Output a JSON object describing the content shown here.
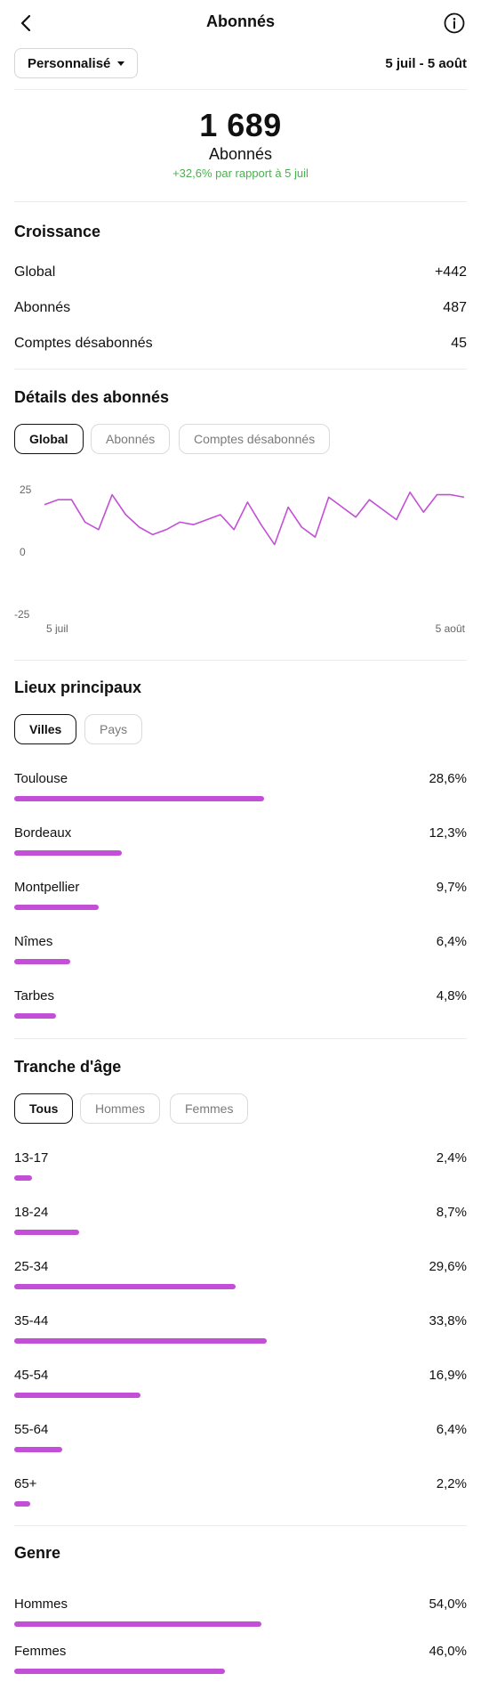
{
  "header": {
    "title": "Abonnés",
    "back_icon": "back-arrow-icon",
    "info_icon": "info-icon"
  },
  "period": {
    "selected": "Personnalisé",
    "date_range": "5 juil - 5 août"
  },
  "summary": {
    "count": "1 689",
    "label": "Abonnés",
    "change": "+32,6% par rapport à 5 juil",
    "change_color": "#4caf50"
  },
  "growth": {
    "title": "Croissance",
    "rows": [
      {
        "label": "Global",
        "value": "+442"
      },
      {
        "label": "Abonnés",
        "value": "487"
      },
      {
        "label": "Comptes désabonnés",
        "value": "45"
      }
    ]
  },
  "details": {
    "title": "Détails des abonnés",
    "tabs": [
      "Global",
      "Abonnés",
      "Comptes désabonnés"
    ],
    "active_tab": "Global"
  },
  "chart_data": {
    "type": "line",
    "x": [
      "5 juil",
      "6 juil",
      "7 juil",
      "8 juil",
      "9 juil",
      "10 juil",
      "11 juil",
      "12 juil",
      "13 juil",
      "14 juil",
      "15 juil",
      "16 juil",
      "17 juil",
      "18 juil",
      "19 juil",
      "20 juil",
      "21 juil",
      "22 juil",
      "23 juil",
      "24 juil",
      "25 juil",
      "26 juil",
      "27 juil",
      "28 juil",
      "29 juil",
      "30 juil",
      "31 juil",
      "1 août",
      "2 août",
      "3 août",
      "4 août",
      "5 août"
    ],
    "series": [
      {
        "values": [
          19,
          21,
          21,
          12,
          9,
          23,
          15,
          10,
          7,
          9,
          12,
          11,
          13,
          15,
          9,
          20,
          11,
          3,
          18,
          10,
          6,
          22,
          18,
          14,
          21,
          17,
          13,
          24,
          16,
          23,
          23,
          22
        ]
      }
    ],
    "x_tick_labels": [
      "5 juil",
      "5 août"
    ],
    "y_ticks": [
      25,
      0,
      -25
    ],
    "ylim": [
      -25,
      25
    ],
    "line_color": "#c34fd6",
    "grid": false
  },
  "locations": {
    "title": "Lieux principaux",
    "tabs": [
      "Villes",
      "Pays"
    ],
    "active_tab": "Villes",
    "rows": [
      {
        "label": "Toulouse",
        "value": "28,6%",
        "pct": 28.6
      },
      {
        "label": "Bordeaux",
        "value": "12,3%",
        "pct": 12.3
      },
      {
        "label": "Montpellier",
        "value": "9,7%",
        "pct": 9.7
      },
      {
        "label": "Nîmes",
        "value": "6,4%",
        "pct": 6.4
      },
      {
        "label": "Tarbes",
        "value": "4,8%",
        "pct": 4.8
      }
    ]
  },
  "age": {
    "title": "Tranche d'âge",
    "tabs": [
      "Tous",
      "Hommes",
      "Femmes"
    ],
    "active_tab": "Tous",
    "rows": [
      {
        "label": "13-17",
        "value": "2,4%",
        "pct": 2.4
      },
      {
        "label": "18-24",
        "value": "8,7%",
        "pct": 8.7
      },
      {
        "label": "25-34",
        "value": "29,6%",
        "pct": 29.6
      },
      {
        "label": "35-44",
        "value": "33,8%",
        "pct": 33.8
      },
      {
        "label": "45-54",
        "value": "16,9%",
        "pct": 16.9
      },
      {
        "label": "55-64",
        "value": "6,4%",
        "pct": 6.4
      },
      {
        "label": "65+",
        "value": "2,2%",
        "pct": 2.2
      }
    ]
  },
  "gender": {
    "title": "Genre",
    "rows": [
      {
        "label": "Hommes",
        "value": "54,0%",
        "pct": 54.0
      },
      {
        "label": "Femmes",
        "value": "46,0%",
        "pct": 46.0
      }
    ]
  },
  "colors": {
    "bar": "#c34fd6",
    "positive": "#4caf50"
  }
}
